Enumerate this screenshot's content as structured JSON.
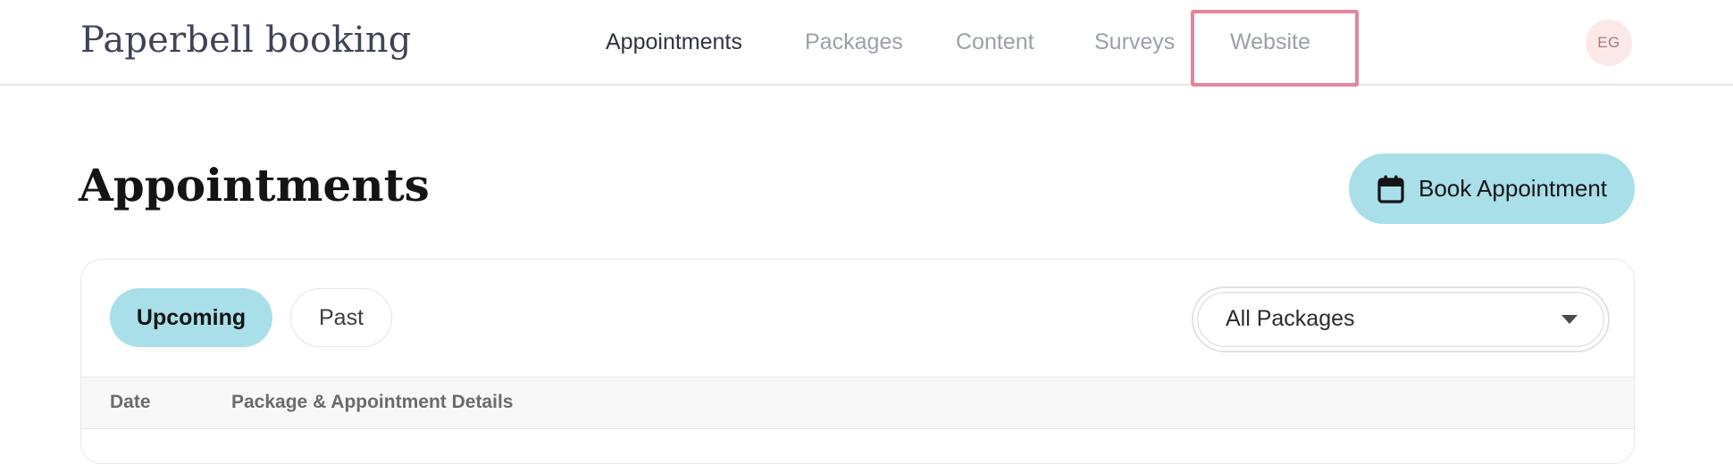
{
  "brand": {
    "name": "Paperbell booking"
  },
  "nav": {
    "items": [
      {
        "label": "Appointments",
        "active": true
      },
      {
        "label": "Packages",
        "active": false
      },
      {
        "label": "Content",
        "active": false
      },
      {
        "label": "Surveys",
        "active": false
      },
      {
        "label": "Website",
        "active": false
      }
    ],
    "highlighted_item": "Website"
  },
  "user": {
    "initials": "EG"
  },
  "page": {
    "title": "Appointments",
    "book_button_label": "Book Appointment",
    "book_button_icon": "calendar-icon"
  },
  "filters": {
    "tabs": [
      {
        "label": "Upcoming",
        "selected": true
      },
      {
        "label": "Past",
        "selected": false
      }
    ],
    "package_select": {
      "value": "All Packages",
      "icon": "caret-down-icon"
    }
  },
  "table": {
    "columns": [
      "Date",
      "Package & Appointment Details"
    ]
  },
  "colors": {
    "accent": "#a8dfe9",
    "highlight_border": "#e5859b",
    "avatar_bg": "#fbe8e8",
    "nav_inactive": "#9ba0aa",
    "nav_active": "#2e3441"
  }
}
